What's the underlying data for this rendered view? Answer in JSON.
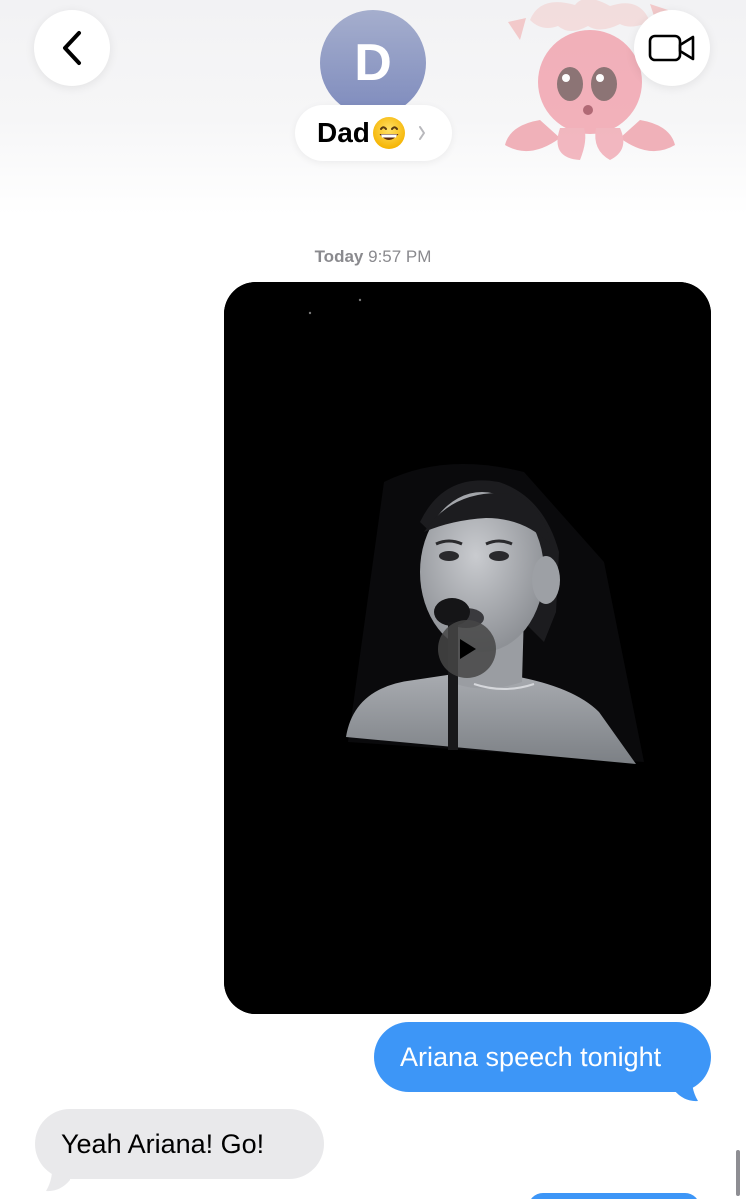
{
  "header": {
    "avatar_initial": "D",
    "contact_name": "Dad",
    "contact_emoji": "grinning-face-emoji",
    "back_icon": "chevron-left-icon",
    "video_icon": "video-camera-icon",
    "sticker": "octopus-memoji-sticker"
  },
  "conversation": {
    "timestamp_day": "Today",
    "timestamp_time": "9:57 PM",
    "messages": [
      {
        "type": "video",
        "direction": "sent",
        "icon": "play-icon"
      },
      {
        "type": "text",
        "direction": "sent",
        "text": "Ariana speech tonight"
      },
      {
        "type": "text",
        "direction": "received",
        "text": "Yeah Ariana!  Go!"
      }
    ]
  },
  "colors": {
    "sent_bubble": "#3d96f7",
    "received_bubble": "#e9e9eb",
    "avatar": "#8b96c4",
    "timestamp": "#8a8a8e"
  }
}
